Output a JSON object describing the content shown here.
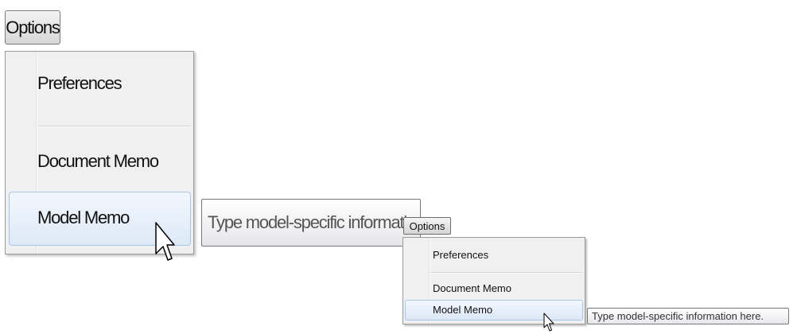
{
  "large": {
    "options_button": "Options",
    "menu_items": [
      "Preferences",
      "Document Memo",
      "Model Memo"
    ],
    "highlighted_item": "Model Memo",
    "tooltip": "Type model-specific information here."
  },
  "small": {
    "options_button": "Options",
    "menu_items": [
      "Preferences",
      "Document Memo",
      "Model Memo"
    ],
    "highlighted_item": "Model Memo",
    "tooltip": "Type model-specific information here."
  },
  "icons": {
    "pointer": "arrow-cursor-icon"
  },
  "colors": {
    "highlight_border": "#a8c6e8",
    "highlight_fill": "#dde9f7",
    "menu_bg": "#f0f0f0"
  }
}
